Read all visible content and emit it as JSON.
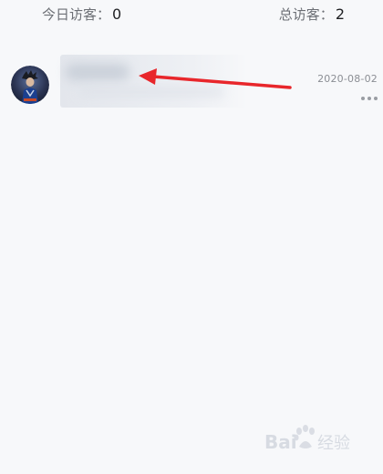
{
  "stats": {
    "today_label": "今日访客：",
    "today_value": "0",
    "total_label": "总访客：",
    "total_value": "2"
  },
  "visitor": {
    "date": "2020-08-02",
    "more_icon": "more-dots-icon"
  },
  "annotation": {
    "arrow_color": "#e8262b"
  },
  "watermark": {
    "text": "Bai经验"
  }
}
